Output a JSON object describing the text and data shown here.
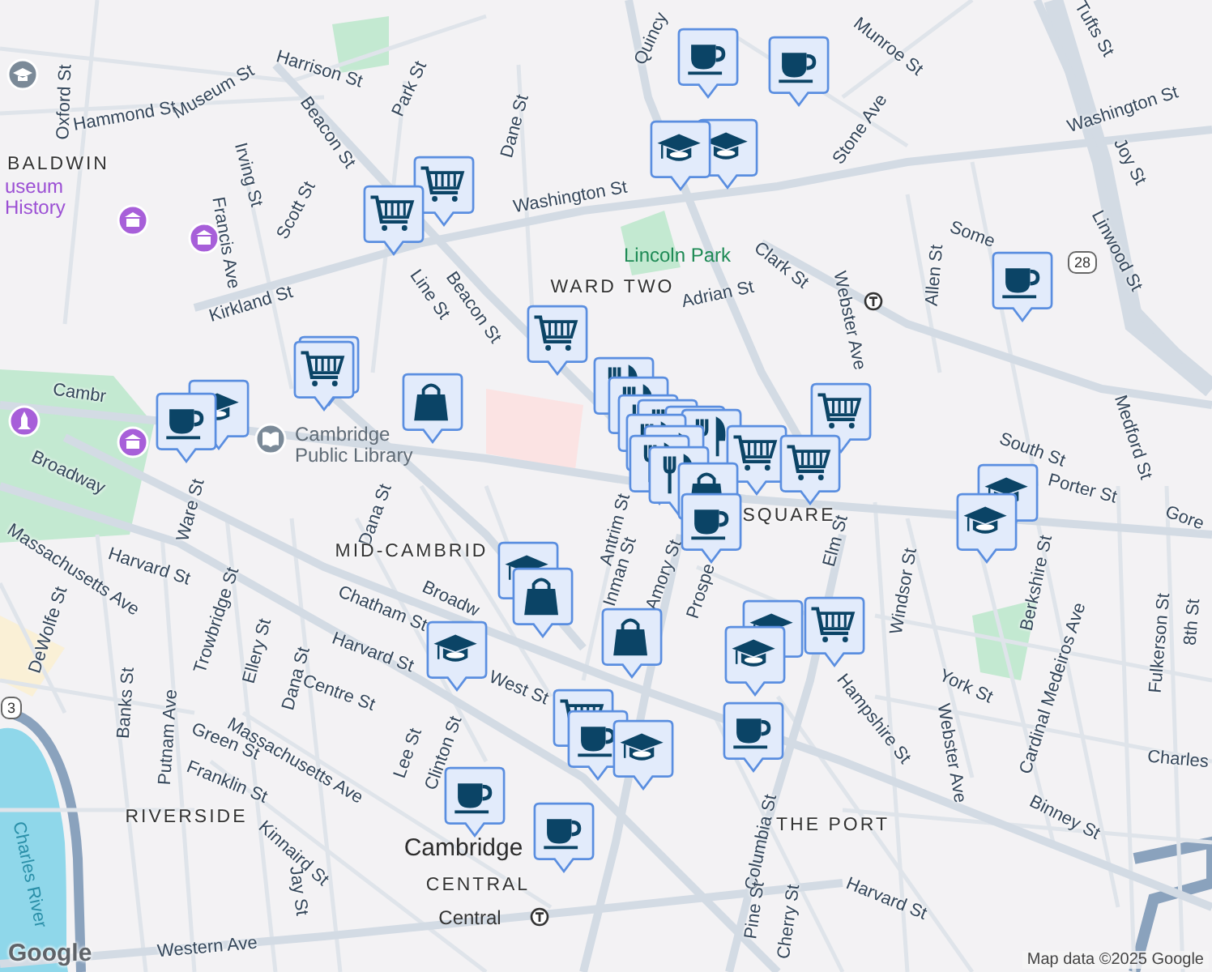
{
  "map": {
    "labels": [
      {
        "kind": "street",
        "text": "Quincy"
      },
      {
        "kind": "street",
        "text": "Munroe St"
      },
      {
        "kind": "street",
        "text": "Tufts St"
      },
      {
        "kind": "street",
        "text": "Harrison St"
      },
      {
        "kind": "street",
        "text": "Park St"
      },
      {
        "kind": "street",
        "text": "Oxford St"
      },
      {
        "kind": "street",
        "text": "Hammond St"
      },
      {
        "kind": "street",
        "text": "Museum St"
      },
      {
        "kind": "street",
        "text": "Beacon St"
      },
      {
        "kind": "street",
        "text": "Dane St"
      },
      {
        "kind": "street",
        "text": "Stone Ave"
      },
      {
        "kind": "street",
        "text": "Washington St"
      },
      {
        "kind": "street",
        "text": "Joy St"
      },
      {
        "kind": "neighborhood",
        "text": "BALDWIN"
      },
      {
        "kind": "street",
        "text": "Irving St"
      },
      {
        "kind": "street",
        "text": "Washington St"
      },
      {
        "kind": "poi",
        "text": "useum History"
      },
      {
        "kind": "street",
        "text": "Scott St"
      },
      {
        "kind": "street",
        "text": "Francis Ave"
      },
      {
        "kind": "park",
        "text": "Lincoln Park"
      },
      {
        "kind": "street",
        "text": "Clark St"
      },
      {
        "kind": "street",
        "text": "Some"
      },
      {
        "kind": "street",
        "text": "Allen St"
      },
      {
        "kind": "street",
        "text": "Linwood St"
      },
      {
        "kind": "street",
        "text": "Kirkland St"
      },
      {
        "kind": "neighborhood",
        "text": "WARD TWO"
      },
      {
        "kind": "street",
        "text": "Adrian St"
      },
      {
        "kind": "street",
        "text": "Webster Ave"
      },
      {
        "kind": "street",
        "text": "Line St"
      },
      {
        "kind": "street",
        "text": "Beacon St"
      },
      {
        "kind": "street",
        "text": "Cambr"
      },
      {
        "kind": "place",
        "text": "Cambridge Public Library"
      },
      {
        "kind": "street",
        "text": "South St"
      },
      {
        "kind": "street",
        "text": "Medford St"
      },
      {
        "kind": "street",
        "text": "Porter St"
      },
      {
        "kind": "street",
        "text": "Broadway"
      },
      {
        "kind": "street",
        "text": "Dana St"
      },
      {
        "kind": "street",
        "text": "Ware St"
      },
      {
        "kind": "neighborhood",
        "text": "SQUARE"
      },
      {
        "kind": "street",
        "text": "Gore"
      },
      {
        "kind": "street",
        "text": "Massachusetts Ave"
      },
      {
        "kind": "neighborhood",
        "text": "MID-CAMBRID"
      },
      {
        "kind": "street",
        "text": "Antrim St"
      },
      {
        "kind": "street",
        "text": "Elm St"
      },
      {
        "kind": "street",
        "text": "Windsor St"
      },
      {
        "kind": "street",
        "text": "Harvard St"
      },
      {
        "kind": "street",
        "text": "Trowbridge St"
      },
      {
        "kind": "street",
        "text": "Inman St"
      },
      {
        "kind": "street",
        "text": "Amory St"
      },
      {
        "kind": "street",
        "text": "Prospe"
      },
      {
        "kind": "street",
        "text": "Berkshire St"
      },
      {
        "kind": "street",
        "text": "Chatham St"
      },
      {
        "kind": "street",
        "text": "Broadw"
      },
      {
        "kind": "street",
        "text": "DeWolfe St"
      },
      {
        "kind": "street",
        "text": "Fulkerson St"
      },
      {
        "kind": "street",
        "text": "8th St"
      },
      {
        "kind": "street",
        "text": "Ellery St"
      },
      {
        "kind": "street",
        "text": "Harvard St"
      },
      {
        "kind": "street",
        "text": "Centre St"
      },
      {
        "kind": "street",
        "text": "Dana St"
      },
      {
        "kind": "street",
        "text": "West St"
      },
      {
        "kind": "street",
        "text": "York St"
      },
      {
        "kind": "street",
        "text": "Cardinal Medeiros Ave"
      },
      {
        "kind": "street",
        "text": "Banks St"
      },
      {
        "kind": "street",
        "text": "Hampshire St"
      },
      {
        "kind": "street",
        "text": "Webster Ave"
      },
      {
        "kind": "street",
        "text": "Green St"
      },
      {
        "kind": "street",
        "text": "Massachusetts Ave"
      },
      {
        "kind": "street",
        "text": "Lee St"
      },
      {
        "kind": "street",
        "text": "Clinton St"
      },
      {
        "kind": "street",
        "text": "Charles"
      },
      {
        "kind": "street",
        "text": "Putnam Ave"
      },
      {
        "kind": "street",
        "text": "Franklin St"
      },
      {
        "kind": "street",
        "text": "Binney St"
      },
      {
        "kind": "neighborhood",
        "text": "RIVERSIDE"
      },
      {
        "kind": "neighborhood",
        "text": "THE PORT"
      },
      {
        "kind": "street",
        "text": "Columbia St"
      },
      {
        "kind": "place",
        "text": "Cambridge"
      },
      {
        "kind": "street",
        "text": "Kinnaird St"
      },
      {
        "kind": "water",
        "text": "Charles River"
      },
      {
        "kind": "neighborhood",
        "text": "CENTRAL"
      },
      {
        "kind": "street",
        "text": "Jay St"
      },
      {
        "kind": "street",
        "text": "Harvard St"
      },
      {
        "kind": "street",
        "text": "Pine St"
      },
      {
        "kind": "transit",
        "text": "Central"
      },
      {
        "kind": "street",
        "text": "Cherry St"
      },
      {
        "kind": "street",
        "text": "Western Ave"
      }
    ],
    "shields": [
      "28",
      "3"
    ],
    "markers": [
      {
        "kind": "cafe"
      },
      {
        "kind": "cafe"
      },
      {
        "kind": "school"
      },
      {
        "kind": "school"
      },
      {
        "kind": "grocery"
      },
      {
        "kind": "grocery"
      },
      {
        "kind": "cafe"
      },
      {
        "kind": "grocery"
      },
      {
        "kind": "grocery"
      },
      {
        "kind": "grocery"
      },
      {
        "kind": "shopping"
      },
      {
        "kind": "school"
      },
      {
        "kind": "cafe"
      },
      {
        "kind": "restaurant"
      },
      {
        "kind": "restaurant"
      },
      {
        "kind": "restaurant"
      },
      {
        "kind": "restaurant"
      },
      {
        "kind": "restaurant"
      },
      {
        "kind": "restaurant"
      },
      {
        "kind": "grocery"
      },
      {
        "kind": "restaurant"
      },
      {
        "kind": "restaurant"
      },
      {
        "kind": "grocery"
      },
      {
        "kind": "grocery"
      },
      {
        "kind": "restaurant"
      },
      {
        "kind": "restaurant"
      },
      {
        "kind": "shopping"
      },
      {
        "kind": "cafe"
      },
      {
        "kind": "school"
      },
      {
        "kind": "school"
      },
      {
        "kind": "school"
      },
      {
        "kind": "shopping"
      },
      {
        "kind": "shopping"
      },
      {
        "kind": "school"
      },
      {
        "kind": "school"
      },
      {
        "kind": "grocery"
      },
      {
        "kind": "school"
      },
      {
        "kind": "grocery"
      },
      {
        "kind": "cafe"
      },
      {
        "kind": "school"
      },
      {
        "kind": "cafe"
      },
      {
        "kind": "cafe"
      },
      {
        "kind": "cafe"
      }
    ],
    "logo": "Google",
    "attribution": "Map data ©2025 Google"
  }
}
